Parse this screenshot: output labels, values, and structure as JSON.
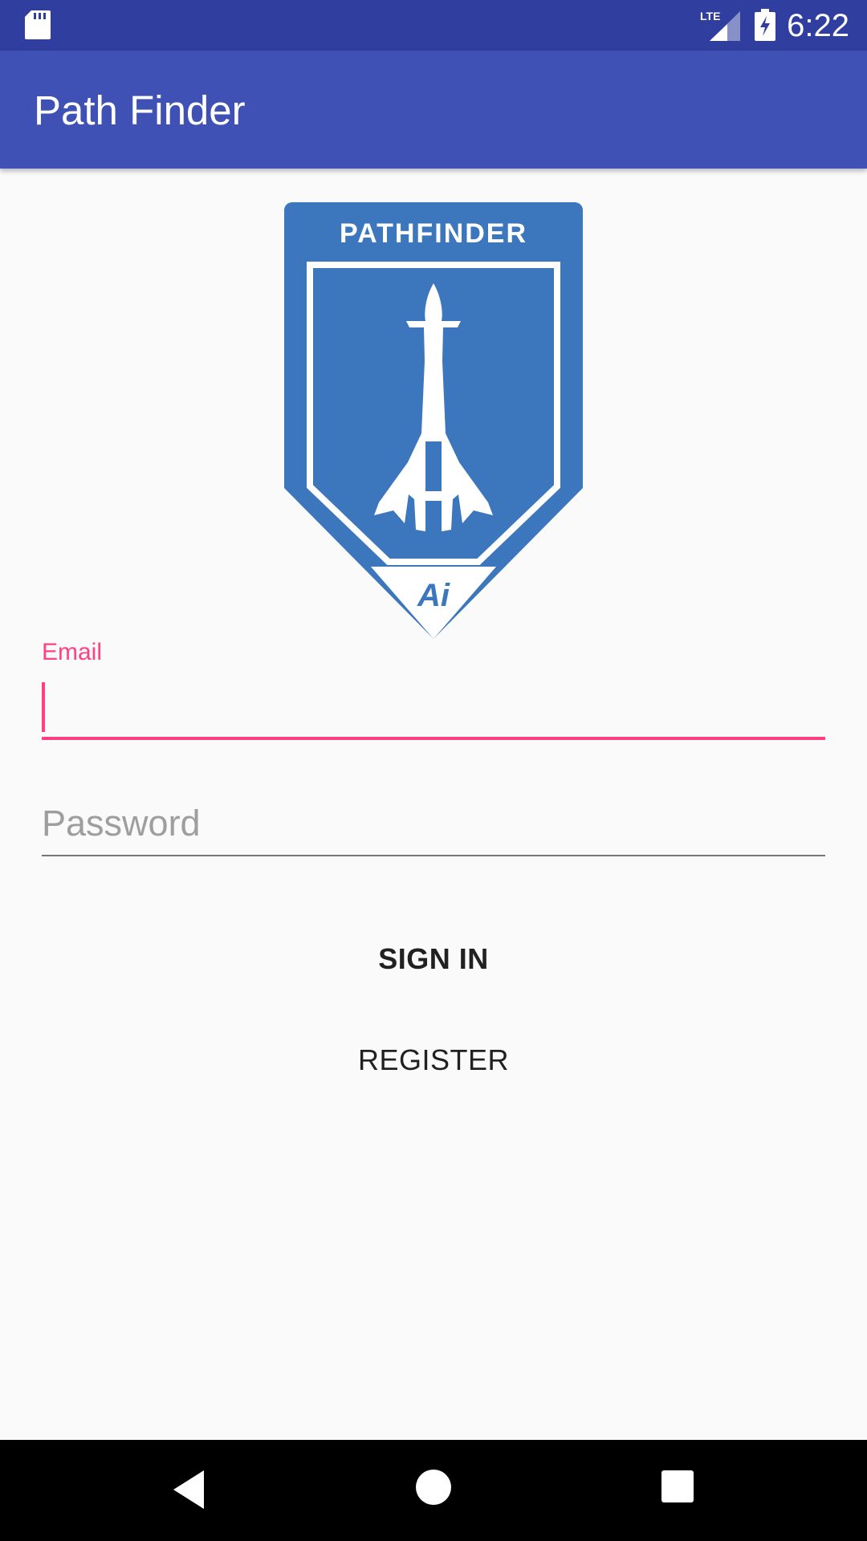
{
  "status_bar": {
    "network_label": "LTE",
    "time": "6:22",
    "icons": [
      "sd-card-icon",
      "lte-signal-icon",
      "battery-charging-icon"
    ]
  },
  "app_bar": {
    "title": "Path Finder",
    "color": "#3f51b5"
  },
  "logo": {
    "text": "PATHFINDER",
    "mark": "Ai",
    "color": "#3c77bd"
  },
  "form": {
    "email": {
      "label": "Email",
      "value": ""
    },
    "password": {
      "placeholder": "Password",
      "value": ""
    },
    "accent_color": "#ff4081"
  },
  "buttons": {
    "sign_in": "SIGN IN",
    "register": "REGISTER"
  },
  "nav_bar": {
    "icons": [
      "back-icon",
      "home-icon",
      "recents-icon"
    ]
  }
}
